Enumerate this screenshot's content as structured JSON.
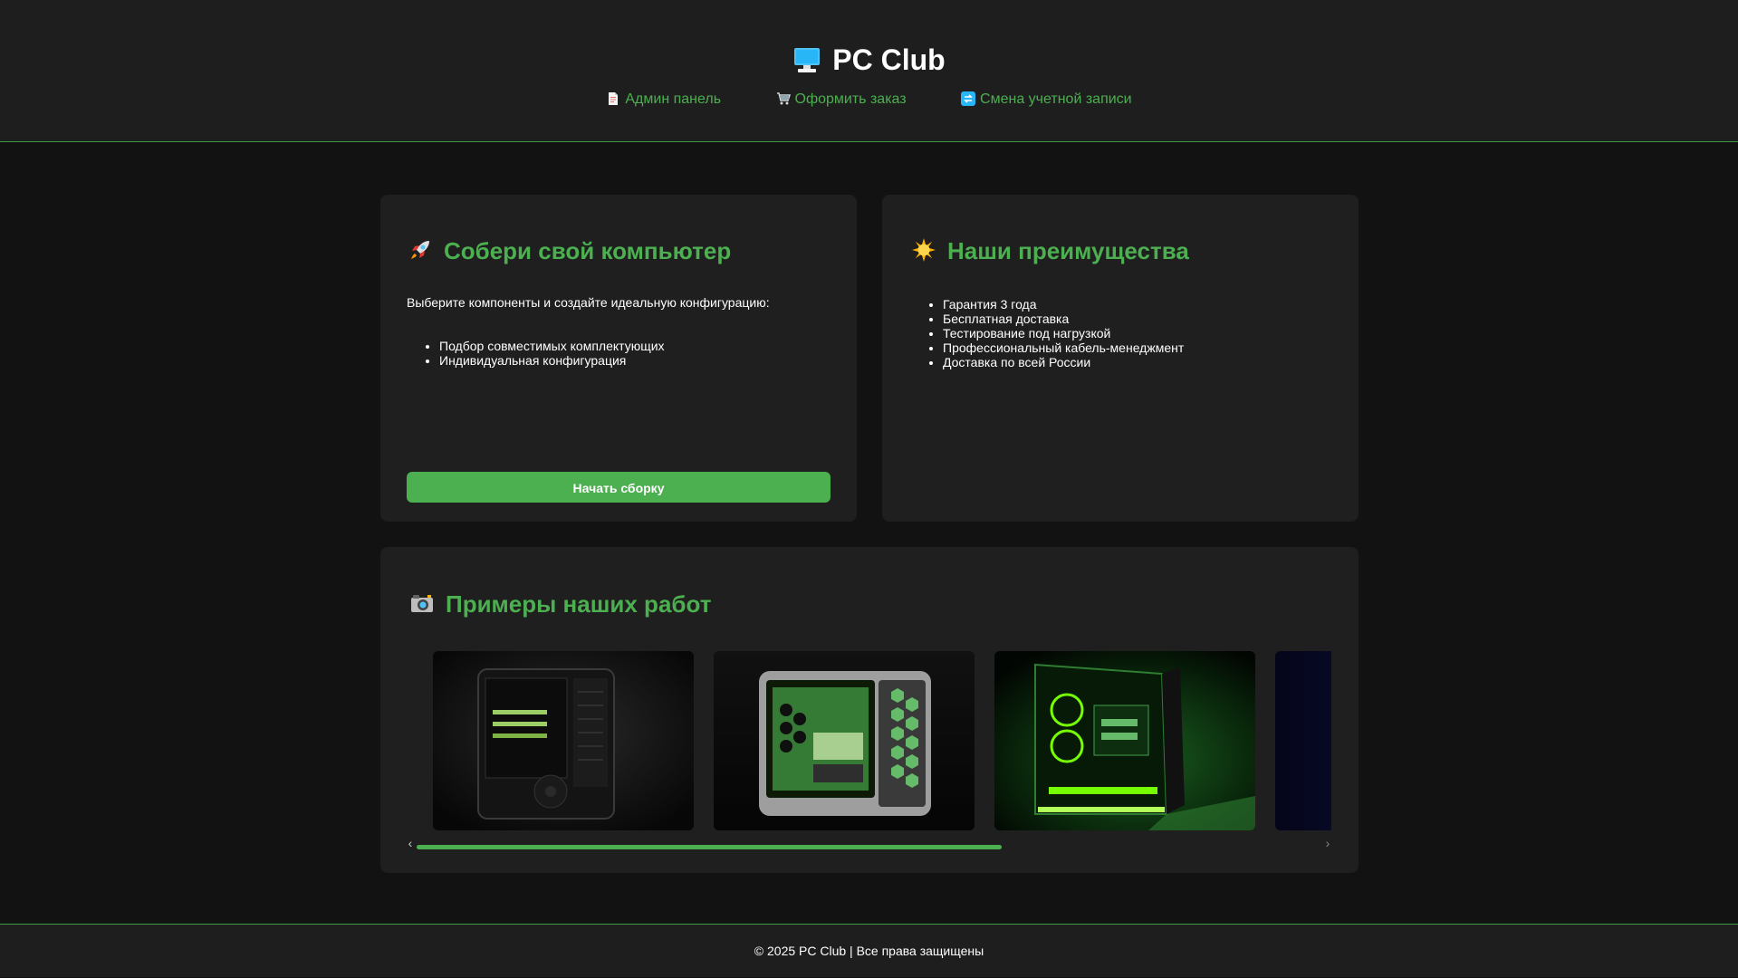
{
  "header": {
    "brand": "PC Club",
    "brand_icon": "desktop-computer-icon",
    "nav": [
      {
        "label": "Админ панель",
        "icon": "page-icon"
      },
      {
        "label": "Оформить заказ",
        "icon": "cart-icon"
      },
      {
        "label": "Смена учетной записи",
        "icon": "switch-arrows-icon"
      }
    ]
  },
  "build": {
    "title": "Собери свой компьютер",
    "icon": "rocket-icon",
    "intro": "Выберите компоненты и создайте идеальную конфигурацию:",
    "items": [
      "Подбор совместимых комплектующих",
      "Индивидуальная конфигурация"
    ],
    "button": "Начать сборку"
  },
  "advantages": {
    "title": "Наши преимущества",
    "icon": "sun-icon",
    "items": [
      "Гарантия 3 года",
      "Бесплатная доставка",
      "Тестирование под нагрузкой",
      "Профессиональный кабель-менеджмент",
      "Доставка по всей России"
    ]
  },
  "gallery": {
    "title": "Примеры наших работ",
    "icon": "camera-icon",
    "images": [
      "black-pc-case-photo",
      "green-hex-pc-case-photo",
      "green-rgb-pc-case-photo",
      "blue-pc-case-photo"
    ],
    "scroll_progress": 0.64
  },
  "footer": {
    "text": "© 2025 PC Club | Все права защищены"
  },
  "colors": {
    "accent": "#4caf50",
    "background": "#121212",
    "panel": "#1f1f1f",
    "header": "#1e1e1e"
  }
}
